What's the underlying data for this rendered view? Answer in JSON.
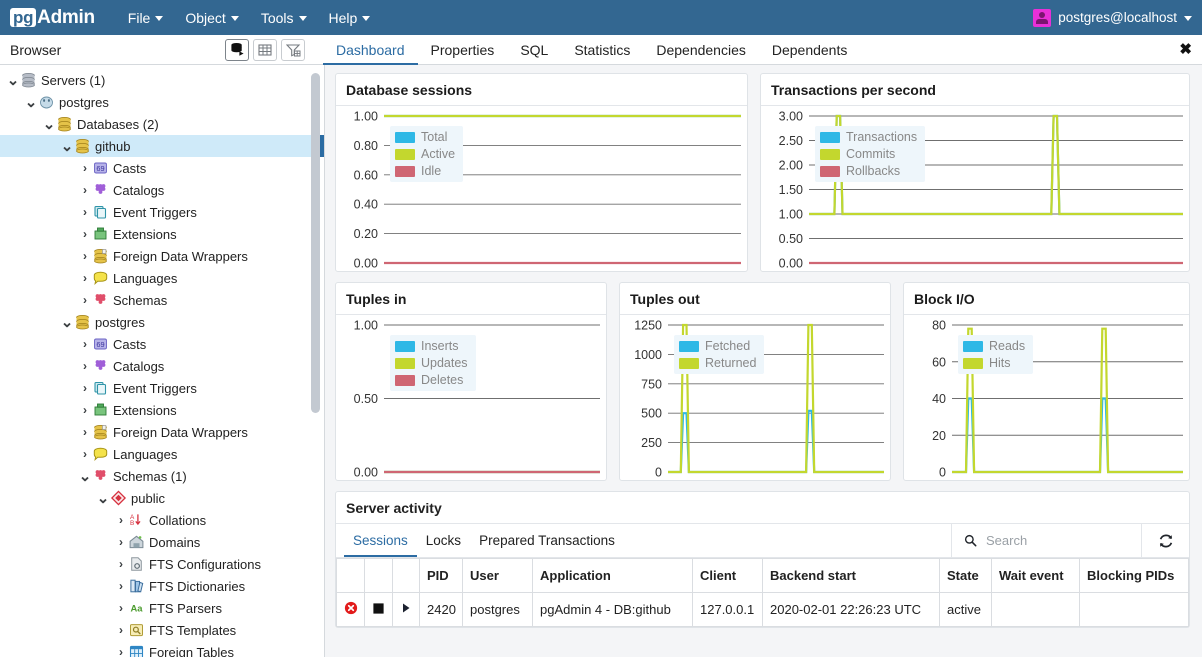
{
  "app": {
    "brand_pg": "pg",
    "brand_admin": "Admin",
    "menus": [
      "File",
      "Object",
      "Tools",
      "Help"
    ],
    "user": "postgres@localhost"
  },
  "browser": {
    "label": "Browser",
    "toolbar": [
      {
        "name": "server-objects-icon",
        "title": "Browser"
      },
      {
        "name": "grid-icon",
        "title": "Grid"
      },
      {
        "name": "filter-icon",
        "title": "Filter"
      }
    ],
    "close_label": "✖"
  },
  "tabs": [
    {
      "label": "Dashboard",
      "active": true
    },
    {
      "label": "Properties",
      "active": false
    },
    {
      "label": "SQL",
      "active": false
    },
    {
      "label": "Statistics",
      "active": false
    },
    {
      "label": "Dependencies",
      "active": false
    },
    {
      "label": "Dependents",
      "active": false
    }
  ],
  "tree": [
    {
      "label": "Servers (1)",
      "depth": 0,
      "state": "open",
      "icon": "servers"
    },
    {
      "label": "postgres",
      "depth": 1,
      "state": "open",
      "icon": "elephant"
    },
    {
      "label": "Databases (2)",
      "depth": 2,
      "state": "open",
      "icon": "databases"
    },
    {
      "label": "github",
      "depth": 3,
      "state": "open",
      "icon": "database",
      "selected": true
    },
    {
      "label": "Casts",
      "depth": 4,
      "state": "closed",
      "icon": "casts"
    },
    {
      "label": "Catalogs",
      "depth": 4,
      "state": "closed",
      "icon": "catalogs"
    },
    {
      "label": "Event Triggers",
      "depth": 4,
      "state": "closed",
      "icon": "event-triggers"
    },
    {
      "label": "Extensions",
      "depth": 4,
      "state": "closed",
      "icon": "extensions"
    },
    {
      "label": "Foreign Data Wrappers",
      "depth": 4,
      "state": "closed",
      "icon": "fdw"
    },
    {
      "label": "Languages",
      "depth": 4,
      "state": "closed",
      "icon": "languages"
    },
    {
      "label": "Schemas",
      "depth": 4,
      "state": "closed",
      "icon": "schemas"
    },
    {
      "label": "postgres",
      "depth": 3,
      "state": "open",
      "icon": "database"
    },
    {
      "label": "Casts",
      "depth": 4,
      "state": "closed",
      "icon": "casts"
    },
    {
      "label": "Catalogs",
      "depth": 4,
      "state": "closed",
      "icon": "catalogs"
    },
    {
      "label": "Event Triggers",
      "depth": 4,
      "state": "closed",
      "icon": "event-triggers"
    },
    {
      "label": "Extensions",
      "depth": 4,
      "state": "closed",
      "icon": "extensions"
    },
    {
      "label": "Foreign Data Wrappers",
      "depth": 4,
      "state": "closed",
      "icon": "fdw"
    },
    {
      "label": "Languages",
      "depth": 4,
      "state": "closed",
      "icon": "languages"
    },
    {
      "label": "Schemas (1)",
      "depth": 4,
      "state": "open",
      "icon": "schemas"
    },
    {
      "label": "public",
      "depth": 5,
      "state": "open",
      "icon": "public"
    },
    {
      "label": "Collations",
      "depth": 6,
      "state": "closed",
      "icon": "collations"
    },
    {
      "label": "Domains",
      "depth": 6,
      "state": "closed",
      "icon": "domains"
    },
    {
      "label": "FTS Configurations",
      "depth": 6,
      "state": "closed",
      "icon": "fts-config"
    },
    {
      "label": "FTS Dictionaries",
      "depth": 6,
      "state": "closed",
      "icon": "fts-dict"
    },
    {
      "label": "FTS Parsers",
      "depth": 6,
      "state": "closed",
      "icon": "fts-parser"
    },
    {
      "label": "FTS Templates",
      "depth": 6,
      "state": "closed",
      "icon": "fts-template"
    },
    {
      "label": "Foreign Tables",
      "depth": 6,
      "state": "closed",
      "icon": "foreign-tables"
    }
  ],
  "colors": {
    "series_blue": "#2eb8e6",
    "series_green": "#c3d72e",
    "series_red": "#cf6673",
    "accent": "#2c6ca3",
    "header": "#336791"
  },
  "chart_data": [
    {
      "id": "database-sessions",
      "type": "line",
      "title": "Database sessions",
      "ylim": [
        0,
        1
      ],
      "yticks": [
        "0.00",
        "0.20",
        "0.40",
        "0.60",
        "0.80",
        "1.00"
      ],
      "grid": true,
      "legend_position": "top-left",
      "series": [
        {
          "name": "Total",
          "color": "#2eb8e6",
          "constant": 1
        },
        {
          "name": "Active",
          "color": "#c3d72e",
          "constant": 1
        },
        {
          "name": "Idle",
          "color": "#cf6673",
          "constant": 0
        }
      ]
    },
    {
      "id": "transactions-per-second",
      "type": "line",
      "title": "Transactions per second",
      "ylim": [
        0,
        3
      ],
      "yticks": [
        "0.00",
        "0.50",
        "1.00",
        "1.50",
        "2.00",
        "2.50",
        "3.00"
      ],
      "grid": true,
      "legend_position": "top-left",
      "series": [
        {
          "name": "Transactions",
          "color": "#2eb8e6",
          "baseline": 1,
          "spikes": [
            {
              "x_pct": 8,
              "value": 3
            },
            {
              "x_pct": 66,
              "value": 3
            }
          ]
        },
        {
          "name": "Commits",
          "color": "#c3d72e",
          "baseline": 1,
          "spikes": [
            {
              "x_pct": 8,
              "value": 3
            },
            {
              "x_pct": 66,
              "value": 3
            }
          ]
        },
        {
          "name": "Rollbacks",
          "color": "#cf6673",
          "constant": 0
        }
      ]
    },
    {
      "id": "tuples-in",
      "type": "line",
      "title": "Tuples in",
      "ylim": [
        0,
        1
      ],
      "yticks": [
        "0.00",
        "0.50",
        "1.00"
      ],
      "grid": true,
      "legend_position": "top-left",
      "series": [
        {
          "name": "Inserts",
          "color": "#2eb8e6",
          "constant": 0
        },
        {
          "name": "Updates",
          "color": "#c3d72e",
          "constant": 0
        },
        {
          "name": "Deletes",
          "color": "#cf6673",
          "constant": 0
        }
      ]
    },
    {
      "id": "tuples-out",
      "type": "line",
      "title": "Tuples out",
      "ylim": [
        0,
        1250
      ],
      "yticks": [
        "0",
        "250",
        "500",
        "750",
        "1000",
        "1250"
      ],
      "grid": true,
      "legend_position": "top-left",
      "series": [
        {
          "name": "Fetched",
          "color": "#2eb8e6",
          "baseline": 0,
          "spikes": [
            {
              "x_pct": 8,
              "value": 500
            },
            {
              "x_pct": 66,
              "value": 520
            }
          ]
        },
        {
          "name": "Returned",
          "color": "#c3d72e",
          "baseline": 0,
          "spikes": [
            {
              "x_pct": 8,
              "value": 1250
            },
            {
              "x_pct": 66,
              "value": 1250
            }
          ]
        }
      ]
    },
    {
      "id": "block-io",
      "type": "line",
      "title": "Block I/O",
      "ylim": [
        0,
        80
      ],
      "yticks": [
        "0",
        "20",
        "40",
        "60",
        "80"
      ],
      "grid": true,
      "legend_position": "top-left",
      "series": [
        {
          "name": "Reads",
          "color": "#2eb8e6",
          "baseline": 0,
          "spikes": [
            {
              "x_pct": 8,
              "value": 40
            },
            {
              "x_pct": 66,
              "value": 40
            }
          ]
        },
        {
          "name": "Hits",
          "color": "#c3d72e",
          "baseline": 0,
          "spikes": [
            {
              "x_pct": 8,
              "value": 78
            },
            {
              "x_pct": 66,
              "value": 78
            }
          ]
        }
      ]
    }
  ],
  "server_activity": {
    "title": "Server activity",
    "tabs": [
      {
        "label": "Sessions",
        "active": true
      },
      {
        "label": "Locks",
        "active": false
      },
      {
        "label": "Prepared Transactions",
        "active": false
      }
    ],
    "search_placeholder": "Search",
    "search_value": "",
    "columns": [
      "",
      "",
      "",
      "PID",
      "User",
      "Application",
      "Client",
      "Backend start",
      "State",
      "Wait event",
      "Blocking PIDs"
    ],
    "rows": [
      {
        "actions": [
          "terminate-icon",
          "cancel-icon",
          "details-icon"
        ],
        "pid": "2420",
        "user": "postgres",
        "application": "pgAdmin 4 - DB:github",
        "client": "127.0.0.1",
        "backend_start": "2020-02-01 22:26:23 UTC",
        "state": "active",
        "wait_event": "",
        "blocking_pids": ""
      }
    ]
  }
}
